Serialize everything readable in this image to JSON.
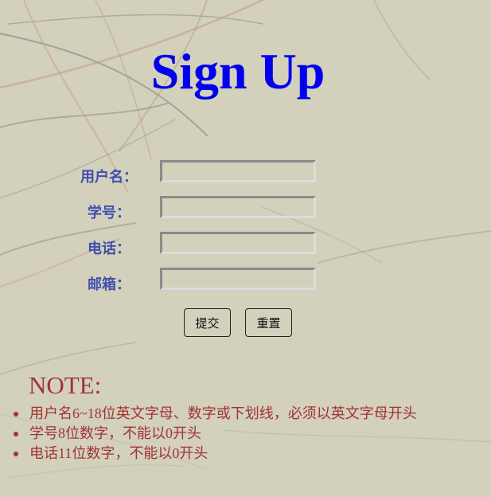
{
  "page": {
    "title": "Sign Up"
  },
  "form": {
    "fields": [
      {
        "label": "用户名：",
        "value": "",
        "placeholder": ""
      },
      {
        "label": "学号：",
        "value": "",
        "placeholder": ""
      },
      {
        "label": "电话：",
        "value": "",
        "placeholder": ""
      },
      {
        "label": "邮箱：",
        "value": "",
        "placeholder": ""
      }
    ],
    "submit_label": "提交",
    "reset_label": "重置"
  },
  "note": {
    "heading": "NOTE:",
    "items": [
      "用户名6~18位英文字母、数字或下划线，必须以英文字母开头",
      "学号8位数字，不能以0开头",
      "电话11位数字，不能以0开头"
    ]
  },
  "colors": {
    "background": "#d3d0bb",
    "title": "#0000ee",
    "label": "#3f4fb0",
    "note": "#a23334"
  }
}
